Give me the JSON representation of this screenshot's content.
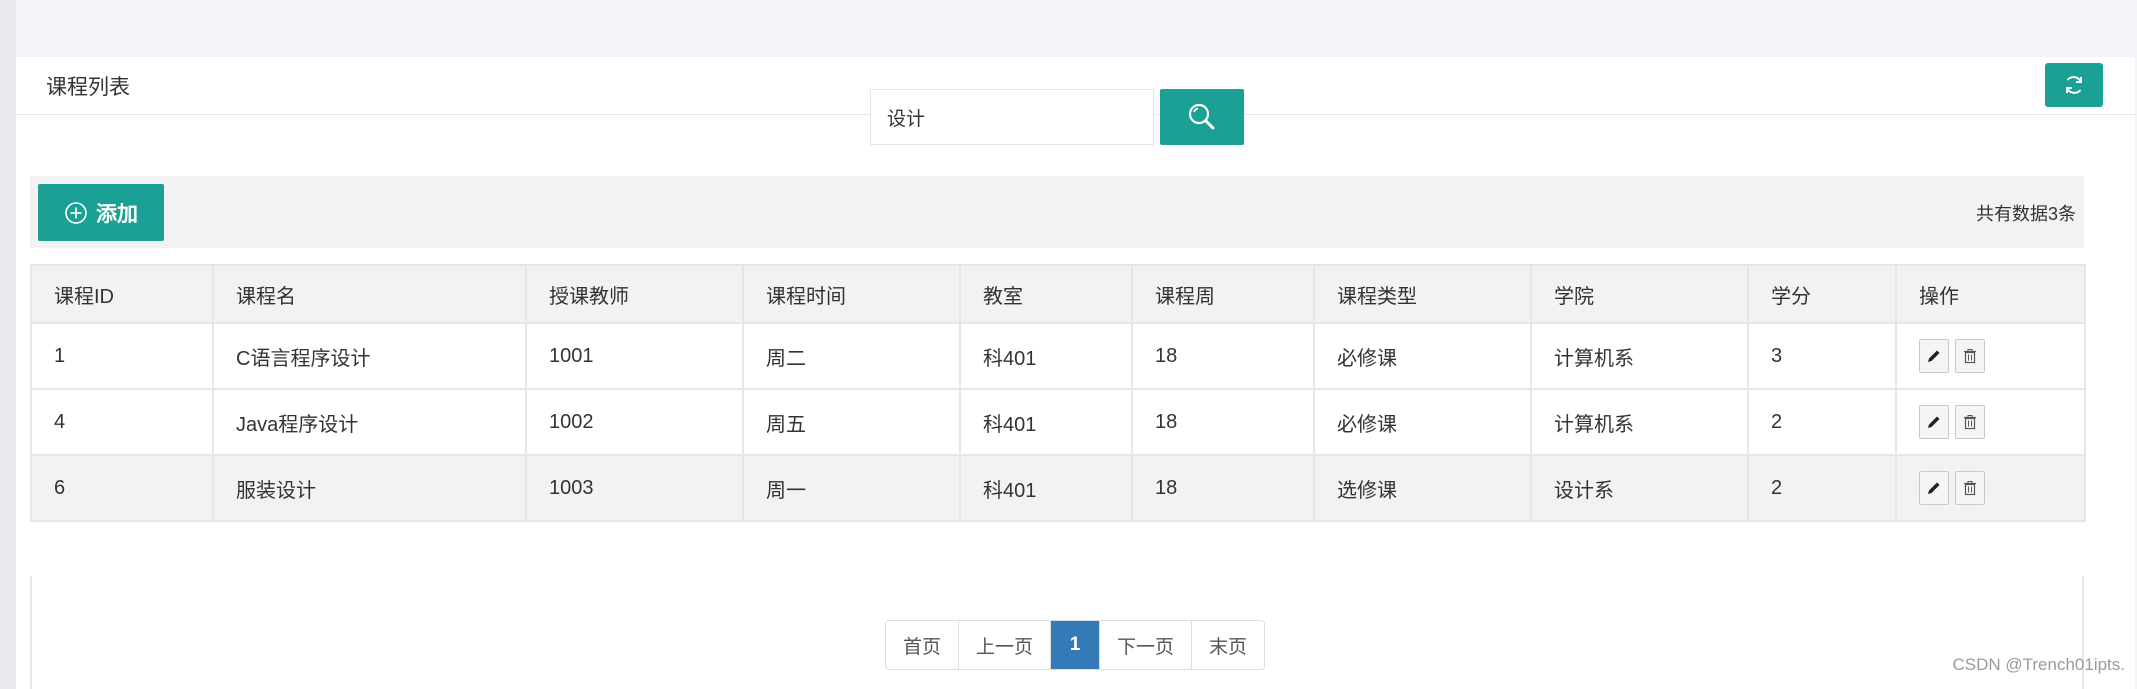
{
  "panel": {
    "title": "课程列表"
  },
  "search": {
    "value": "设计"
  },
  "toolbar": {
    "add_label": "添加",
    "total_text": "共有数据3条"
  },
  "table": {
    "columns": [
      "课程ID",
      "课程名",
      "授课教师",
      "课程时间",
      "教室",
      "课程周",
      "课程类型",
      "学院",
      "学分",
      "操作"
    ],
    "rows": [
      [
        "1",
        "C语言程序设计",
        "1001",
        "周二",
        "科401",
        "18",
        "必修课",
        "计算机系",
        "3"
      ],
      [
        "4",
        "Java程序设计",
        "1002",
        "周五",
        "科401",
        "18",
        "必修课",
        "计算机系",
        "2"
      ],
      [
        "6",
        "服装设计",
        "1003",
        "周一",
        "科401",
        "18",
        "选修课",
        "设计系",
        "2"
      ]
    ]
  },
  "pagination": {
    "first": "首页",
    "prev": "上一页",
    "current": "1",
    "next": "下一页",
    "last": "末页"
  },
  "watermark": "CSDN @Trench01ipts.",
  "colors": {
    "accent": "#1aa094",
    "page_active": "#337ab7"
  },
  "icons": {
    "refresh": "refresh-icon",
    "search": "search-icon",
    "add": "plus-circle-icon",
    "edit": "pencil-icon",
    "delete": "trash-icon"
  }
}
